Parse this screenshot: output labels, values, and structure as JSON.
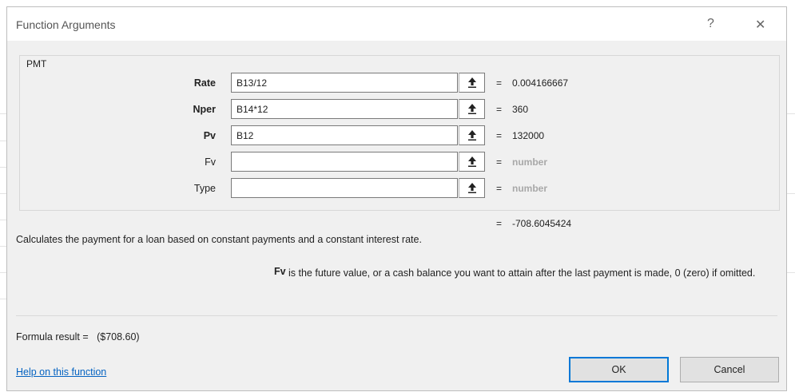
{
  "window": {
    "title": "Function Arguments",
    "help_glyph": "?",
    "close_glyph": "✕"
  },
  "function_group": {
    "name": "PMT"
  },
  "arguments": [
    {
      "label": "Rate",
      "bold": true,
      "value": "B13/12",
      "result": "0.004166667",
      "hint": false
    },
    {
      "label": "Nper",
      "bold": true,
      "value": "B14*12",
      "result": "360",
      "hint": false
    },
    {
      "label": "Pv",
      "bold": true,
      "value": "B12",
      "result": "132000",
      "hint": false
    },
    {
      "label": "Fv",
      "bold": false,
      "value": "",
      "result": "number",
      "hint": true
    },
    {
      "label": "Type",
      "bold": false,
      "value": "",
      "result": "number",
      "hint": true
    }
  ],
  "equals": "=",
  "overall_result": "-708.6045424",
  "description": "Calculates the payment for a loan based on constant payments and a constant interest rate.",
  "argument_help": {
    "name": "Fv",
    "text": "is the future value, or a cash balance you want to attain after the last payment is made, 0 (zero) if omitted."
  },
  "formula_result": {
    "label": "Formula result =",
    "value": "($708.60)"
  },
  "help_link": "Help on this function",
  "buttons": {
    "ok": "OK",
    "cancel": "Cancel"
  },
  "colors": {
    "link": "#0563c1",
    "ok_border": "#0078d7",
    "dialog_bg": "#f0f0f0"
  },
  "icons": {
    "collapse_dialog": "collapse-dialog-icon"
  }
}
